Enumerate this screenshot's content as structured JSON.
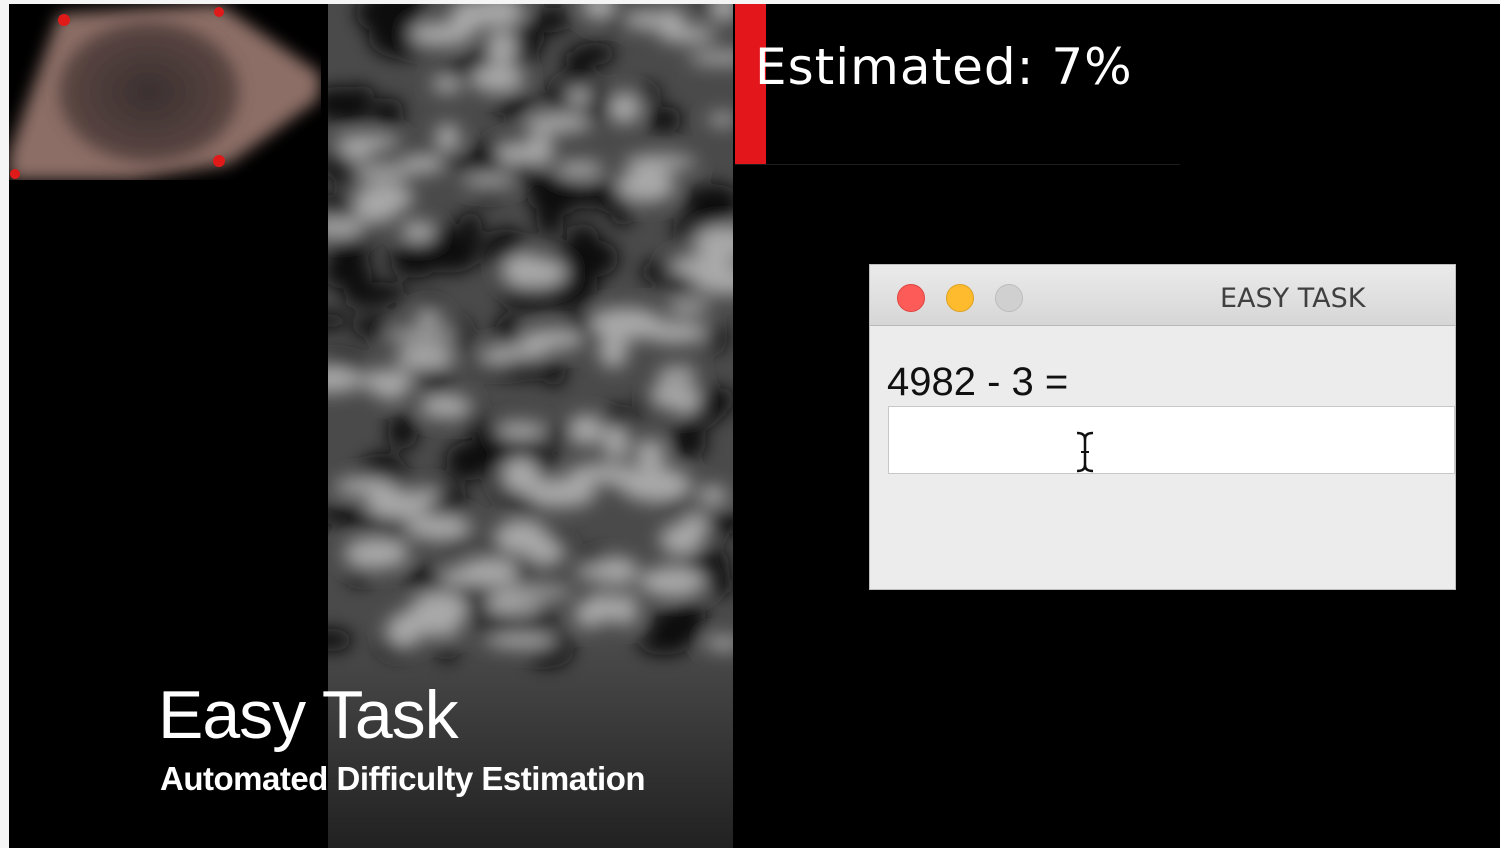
{
  "estimate": {
    "label": "Estimated:  7%",
    "level": 0.07,
    "bar_color": "#e3161b"
  },
  "task_window": {
    "title": "EASY TASK",
    "question": "4982 - 3 =",
    "answer_value": "",
    "controls": {
      "close_color": "#fc5b57",
      "minimize_color": "#fdbb2d",
      "zoom_color": "#d0d0d0"
    }
  },
  "caption": {
    "title": "Easy Task",
    "subtitle": "Automated Difficulty Estimation"
  }
}
